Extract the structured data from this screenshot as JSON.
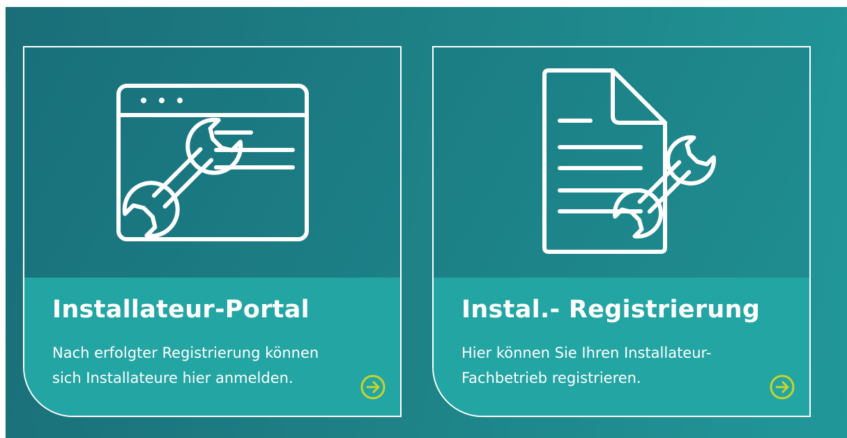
{
  "cards": [
    {
      "title": "Installateur-Portal",
      "desc_line1": "Nach erfolgter Registrierung können",
      "desc_line2": "sich Installateure hier anmelden.",
      "icon": "browser-wrench-icon",
      "arrow_icon": "arrow-right-circle-icon"
    },
    {
      "title": "Instal.- Registrierung",
      "desc_line1": "Hier können Sie Ihren Installateur-",
      "desc_line2": "Fachbetrieb registrieren.",
      "icon": "document-wrench-icon",
      "arrow_icon": "arrow-right-circle-icon"
    }
  ],
  "colors": {
    "panel": "#1e8488",
    "card_bottom": "#23a5a3",
    "arrow": "#c8d42a",
    "text": "#ffffff"
  }
}
